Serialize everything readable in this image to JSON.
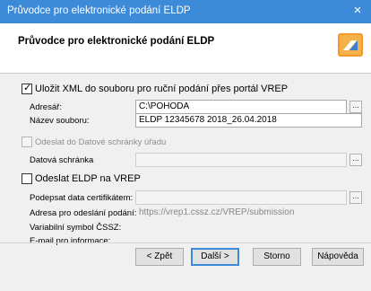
{
  "window": {
    "title": "Průvodce pro elektronické podání ELDP",
    "close_glyph": "×"
  },
  "header": {
    "title": "Průvodce pro elektronické podání ELDP",
    "logo_icon": "wizard-logo-icon"
  },
  "save_xml": {
    "label": "Uložit XML do souboru pro ruční podání přes portál VREP",
    "checked": true
  },
  "address": {
    "label": "Adresář:",
    "value": "C:\\POHODA",
    "browse": "..."
  },
  "filename": {
    "label": "Název souboru:",
    "value": "ELDP 12345678 2018_26.04.2018"
  },
  "datova": {
    "checkbox_label": "Odeslat do Datové schránky úřadu",
    "field_label": "Datová schránka",
    "browse": "..."
  },
  "vrep": {
    "checkbox_label": "Odeslat ELDP na VREP",
    "sign_label": "Podepsat data certifikátem:",
    "url_label": "Adresa pro odeslání podání:",
    "url_value": "https://vrep1.cssz.cz/VREP/submission",
    "vs_label": "Variabilní symbol ČSSZ:",
    "email_label": "E-mail pro informace:",
    "browse": "..."
  },
  "buttons": {
    "back": "< Zpět",
    "next": "Další >",
    "cancel": "Storno",
    "help": "Nápověda"
  },
  "colors": {
    "titlebar": "#3c8ad8",
    "accent": "#3c8ad8"
  }
}
